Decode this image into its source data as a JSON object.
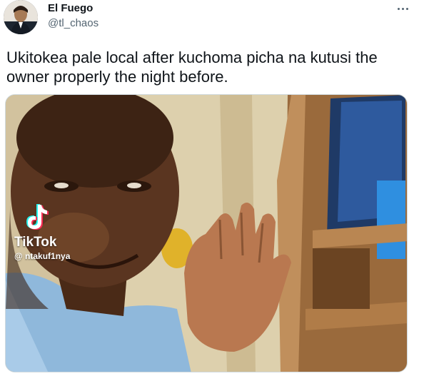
{
  "author": {
    "display_name": "El Fuego",
    "handle": "@tl_chaos"
  },
  "tweet": {
    "text": "Ukitokea pale local after kuchoma picha na kutusi the owner properly the night before."
  },
  "media": {
    "type": "video-frame",
    "watermark": {
      "brand": "TikTok",
      "username": "@ ntakuf1nya"
    }
  },
  "icons": {
    "more": "more-horizontal-icon",
    "watermark": "tiktok-logo-icon"
  },
  "colors": {
    "name": "#0f1419",
    "secondary": "#536471",
    "border": "#cfd9de"
  }
}
